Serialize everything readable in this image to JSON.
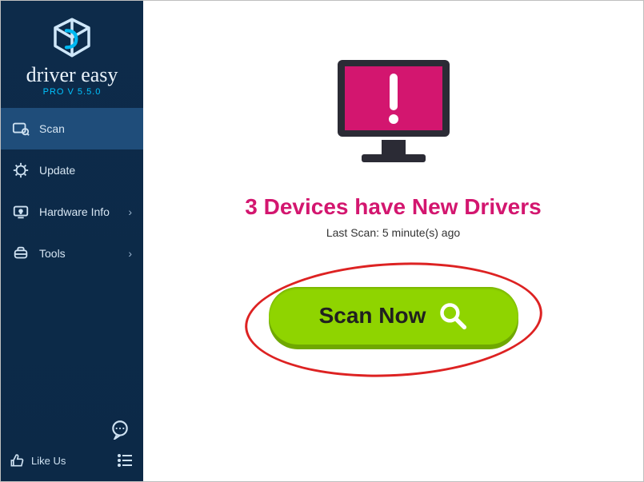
{
  "window": {
    "minimize_glyph": "—",
    "close_glyph": "✕"
  },
  "brand": {
    "name": "driver easy",
    "subtitle": "PRO V 5.5.0"
  },
  "sidebar": {
    "items": [
      {
        "label": "Scan",
        "icon": "scan-icon",
        "active": true,
        "expandable": false
      },
      {
        "label": "Update",
        "icon": "update-icon",
        "active": false,
        "expandable": false
      },
      {
        "label": "Hardware Info",
        "icon": "hardware-icon",
        "active": false,
        "expandable": true
      },
      {
        "label": "Tools",
        "icon": "tools-icon",
        "active": false,
        "expandable": true
      }
    ],
    "like_label": "Like Us",
    "chevron_glyph": "›"
  },
  "main": {
    "headline": "3 Devices have New Drivers",
    "last_scan": "Last Scan: 5 minute(s) ago",
    "scan_button": "Scan Now"
  },
  "colors": {
    "accent_pink": "#d3166f",
    "accent_green": "#8fd400",
    "sidebar_bg": "#0d2b4a",
    "sidebar_active": "#1f4d7a",
    "brand_cyan": "#00c3ff"
  }
}
